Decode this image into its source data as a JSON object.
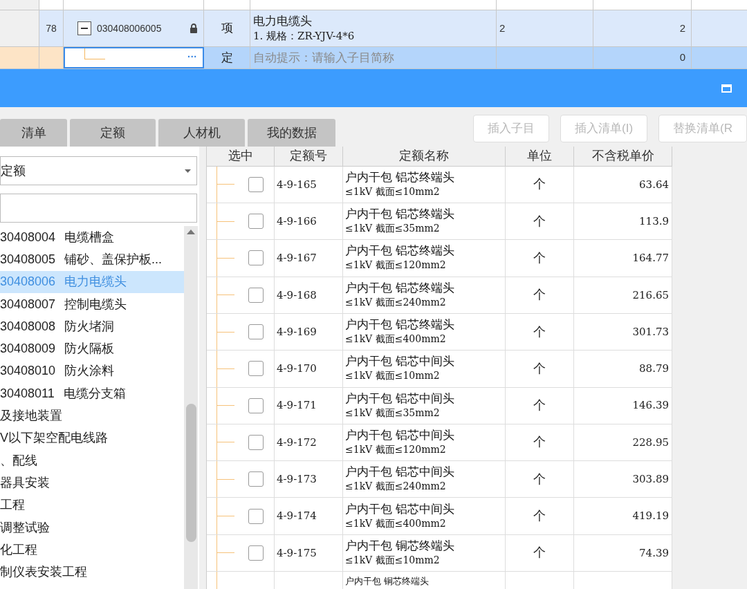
{
  "grid": {
    "rows": [
      {
        "kind": "item",
        "number": "78",
        "expanded": true,
        "code": "030408006005",
        "locked": true,
        "type": "项",
        "name": "电力电缆头",
        "spec": "1. 规格：ZR-YJV-4*6",
        "quantity": "2",
        "total": "2"
      },
      {
        "kind": "new",
        "type": "定",
        "placeholder": "自动提示：请输入子目简称",
        "more": "···",
        "total": "0"
      }
    ]
  },
  "tabs": [
    {
      "label": "清单",
      "selected": false
    },
    {
      "label": "定额",
      "selected": false
    },
    {
      "label": "人材机",
      "selected": false
    },
    {
      "label": "我的数据",
      "selected": false
    }
  ],
  "buttons": [
    {
      "label": "插入子目",
      "disabled": true
    },
    {
      "label": "插入清单(I)",
      "disabled": true
    },
    {
      "label": "替换清单(R",
      "disabled": true
    }
  ],
  "library": {
    "value": "定额"
  },
  "tree": [
    {
      "code": "30408004",
      "name": "电缆槽盒",
      "selected": false
    },
    {
      "code": "30408005",
      "name": "铺砂、盖保护板...",
      "selected": false
    },
    {
      "code": "30408006",
      "name": "电力电缆头",
      "selected": true
    },
    {
      "code": "30408007",
      "name": "控制电缆头",
      "selected": false
    },
    {
      "code": "30408008",
      "name": "防火堵洞",
      "selected": false
    },
    {
      "code": "30408009",
      "name": "防火隔板",
      "selected": false
    },
    {
      "code": "30408010",
      "name": "防火涂料",
      "selected": false
    },
    {
      "code": "30408011",
      "name": "电缆分支箱",
      "selected": false
    },
    {
      "name": "及接地装置",
      "selected": false
    },
    {
      "name": "V以下架空配电线路",
      "selected": false
    },
    {
      "name": "、配线",
      "selected": false
    },
    {
      "name": "器具安装",
      "selected": false
    },
    {
      "name": "工程",
      "selected": false
    },
    {
      "name": "调整试验",
      "selected": false
    },
    {
      "name": "化工程",
      "selected": false
    },
    {
      "name": "制仪表安装工程",
      "selected": false
    }
  ],
  "table": {
    "columns": [
      "选中",
      "定额号",
      "定额名称",
      "单位",
      "不含税单价"
    ],
    "rows": [
      {
        "checked": false,
        "code": "4-9-165",
        "name": "户内干包 铝芯终端头",
        "spec": "≤1kV 截面≤10mm2",
        "unit": "个",
        "price": "63.64"
      },
      {
        "checked": false,
        "code": "4-9-166",
        "name": "户内干包 铝芯终端头",
        "spec": "≤1kV 截面≤35mm2",
        "unit": "个",
        "price": "113.9"
      },
      {
        "checked": false,
        "code": "4-9-167",
        "name": "户内干包 铝芯终端头",
        "spec": "≤1kV 截面≤120mm2",
        "unit": "个",
        "price": "164.77"
      },
      {
        "checked": false,
        "code": "4-9-168",
        "name": "户内干包 铝芯终端头",
        "spec": "≤1kV 截面≤240mm2",
        "unit": "个",
        "price": "216.65"
      },
      {
        "checked": false,
        "code": "4-9-169",
        "name": "户内干包 铝芯终端头",
        "spec": "≤1kV 截面≤400mm2",
        "unit": "个",
        "price": "301.73"
      },
      {
        "checked": false,
        "code": "4-9-170",
        "name": "户内干包 铝芯中间头",
        "spec": "≤1kV 截面≤10mm2",
        "unit": "个",
        "price": "88.79"
      },
      {
        "checked": false,
        "code": "4-9-171",
        "name": "户内干包 铝芯中间头",
        "spec": "≤1kV 截面≤35mm2",
        "unit": "个",
        "price": "146.39"
      },
      {
        "checked": false,
        "code": "4-9-172",
        "name": "户内干包 铝芯中间头",
        "spec": "≤1kV 截面≤120mm2",
        "unit": "个",
        "price": "228.95"
      },
      {
        "checked": false,
        "code": "4-9-173",
        "name": "户内干包 铝芯中间头",
        "spec": "≤1kV 截面≤240mm2",
        "unit": "个",
        "price": "303.89"
      },
      {
        "checked": false,
        "code": "4-9-174",
        "name": "户内干包 铝芯中间头",
        "spec": "≤1kV 截面≤400mm2",
        "unit": "个",
        "price": "419.19"
      },
      {
        "checked": false,
        "code": "4-9-175",
        "name": "户内干包 铜芯终端头",
        "spec": "≤1kV 截面≤10mm2",
        "unit": "个",
        "price": "74.39"
      }
    ],
    "partial_row": {
      "name": "户内干包 铜芯终端头"
    }
  }
}
